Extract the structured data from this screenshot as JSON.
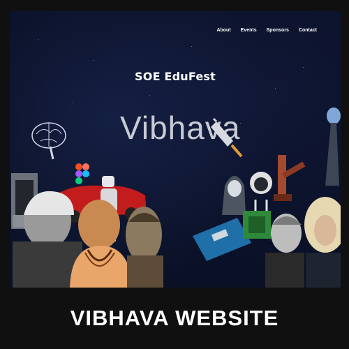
{
  "nav": {
    "items": [
      "About",
      "Events",
      "Sponsors",
      "Contact"
    ]
  },
  "hero": {
    "subtitle": "SOE EduFest",
    "title": "Vibhava"
  },
  "caption": "VIBHAVA WEBSITE",
  "colors": {
    "page_bg": "#101010",
    "site_bg": "#0a1026",
    "nav_text": "#ffffff",
    "title_text": "#c8cbd3",
    "caption_text": "#ffffff"
  },
  "icons": [
    "brain-icon",
    "3d-printer-icon",
    "figma-logo-icon",
    "robot-icon",
    "rocket-icon",
    "github-octocat-icon",
    "arduino-board-icon",
    "circuit-chip-icon",
    "tesla-tower-icon"
  ]
}
